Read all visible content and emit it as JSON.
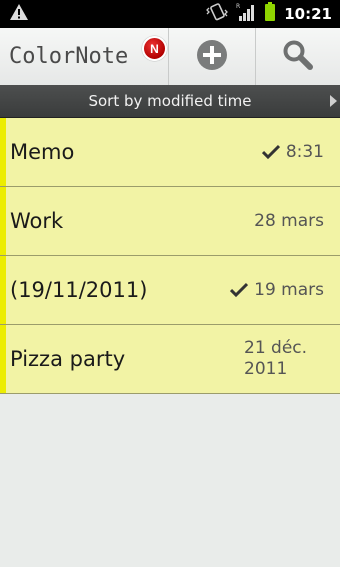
{
  "status_bar": {
    "time": "10:21",
    "icons": [
      "warning-icon",
      "vibrate-icon",
      "signal-icon",
      "battery-icon"
    ]
  },
  "action_bar": {
    "app_title": "ColorNote",
    "badge": "N",
    "actions": [
      "add-note-icon",
      "search-icon"
    ]
  },
  "sort_bar": {
    "label": "Sort by modified time"
  },
  "notes": [
    {
      "title": "Memo",
      "date": "8:31",
      "checked": true
    },
    {
      "title": "Work",
      "date": "28 mars",
      "checked": false
    },
    {
      "title": "(19/11/2011)",
      "date": "19 mars",
      "checked": true
    },
    {
      "title": "Pizza party",
      "date_line1": "21 déc.",
      "date_line2": "2011",
      "checked": false
    }
  ],
  "colors": {
    "note_background": "#f2f3a5",
    "note_stripe": "#eced00",
    "sort_bar": "#444646",
    "badge": "#c40000"
  }
}
